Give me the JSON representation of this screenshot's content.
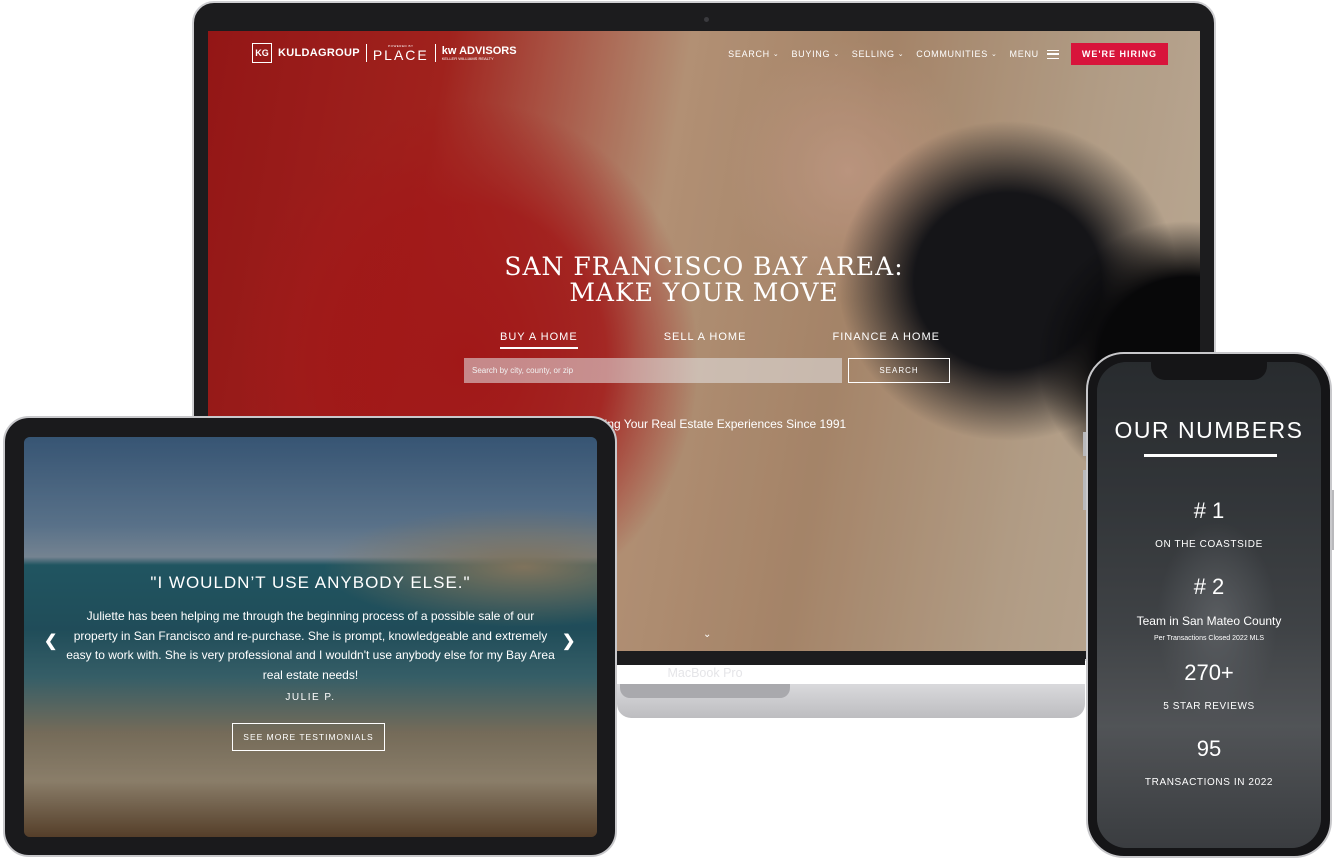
{
  "laptop": {
    "device_label": "MacBook Pro",
    "logo": {
      "monogram": "KG",
      "brand": "KULDAGROUP",
      "powered_by": "POWERED BY",
      "place": "PLACE",
      "kw": "kw ADVISORS",
      "kw_sub": "KELLER WILLIAMS REALTY"
    },
    "nav": {
      "items": [
        "SEARCH",
        "BUYING",
        "SELLING",
        "COMMUNITIES"
      ],
      "menu_label": "MENU",
      "hiring_label": "WE'RE HIRING"
    },
    "hero": {
      "title_line1": "SAN FRANCISCO BAY AREA:",
      "title_line2": "MAKE YOUR MOVE",
      "tabs": [
        "BUY A HOME",
        "SELL A HOME",
        "FINANCE A HOME"
      ],
      "search_placeholder": "Search by city, county, or zip",
      "search_button": "SEARCH",
      "tagline": "ning Your Real Estate Experiences Since 1991"
    }
  },
  "tablet": {
    "quote_title": "\"I WOULDN’T USE ANYBODY ELSE.\"",
    "quote_body": "Juliette has been helping me through the beginning process of a possible sale of our property in San Francisco and re-purchase. She is prompt, knowledgeable and extremely easy to work with. She is very professional and I wouldn't use anybody else for my Bay Area real estate needs!",
    "author": "JULIE P.",
    "button_label": "SEE MORE TESTIMONIALS"
  },
  "phone": {
    "title": "OUR NUMBERS",
    "stats": [
      {
        "value": "# 1",
        "label": "ON THE COASTSIDE"
      },
      {
        "value": "# 2",
        "label": "Team in San Mateo County",
        "sub": "Per Transactions Closed 2022 MLS"
      },
      {
        "value": "270+",
        "label": "5 STAR REVIEWS"
      },
      {
        "value": "95",
        "label": "TRANSACTIONS IN 2022"
      }
    ]
  },
  "colors": {
    "accent": "#d8143b",
    "device_frame": "#1c1c1e"
  }
}
